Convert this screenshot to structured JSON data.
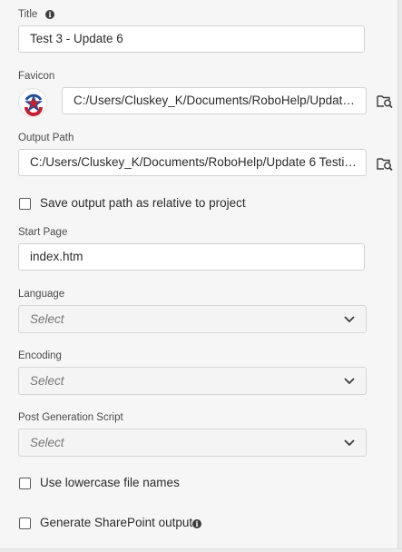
{
  "title_section": {
    "label": "Title",
    "value": "Test 3 - Update 6"
  },
  "favicon_section": {
    "label": "Favicon",
    "path": "C:/Users/Cluskey_K/Documents/RoboHelp/Update ..."
  },
  "output_path_section": {
    "label": "Output Path",
    "path": "C:/Users/Cluskey_K/Documents/RoboHelp/Update 6 Testing..."
  },
  "relative_path_option": {
    "label": "Save output path as relative to project",
    "checked": false
  },
  "start_page_section": {
    "label": "Start Page",
    "value": "index.htm"
  },
  "language_section": {
    "label": "Language",
    "selected": "Select"
  },
  "encoding_section": {
    "label": "Encoding",
    "selected": "Select"
  },
  "post_generation_section": {
    "label": "Post Generation Script",
    "selected": "Select"
  },
  "lowercase_option": {
    "label": "Use lowercase file names",
    "checked": false
  },
  "sharepoint_option": {
    "label": "Generate SharePoint output",
    "checked": false
  },
  "icons": {
    "info": "info-icon",
    "browse": "folder-search-icon",
    "dropdown": "chevron-down-icon",
    "favicon": "star-badge-icon"
  },
  "colors": {
    "panel_bg": "#f6f6f6",
    "field_bg": "#ffffff",
    "favicon_red": "#c8202f",
    "favicon_blue": "#1f4e9a"
  }
}
